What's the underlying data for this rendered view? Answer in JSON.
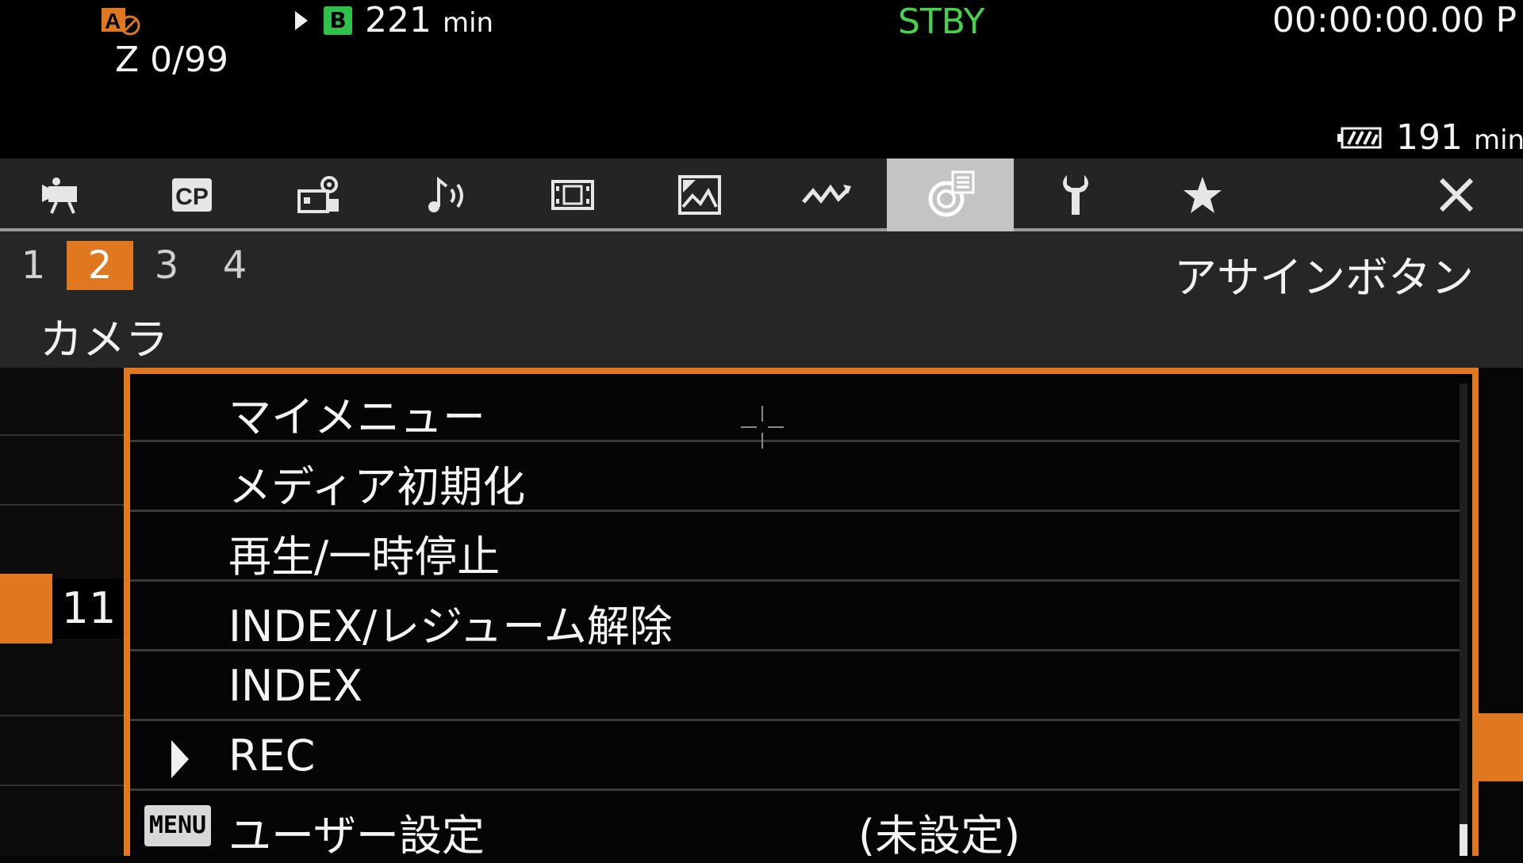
{
  "status_bar": {
    "af_icon": "af-lock-icon",
    "z_count": "Z 0/99",
    "slot": "B",
    "record_time": "221",
    "record_unit": "min",
    "mode": "STBY",
    "timecode": "00:00:00.00 P",
    "battery_time": "191",
    "battery_unit": "min"
  },
  "tabs": [
    {
      "name": "camera-icon",
      "active": false
    },
    {
      "name": "cp-icon",
      "label": "CP",
      "active": false
    },
    {
      "name": "camera-settings-icon",
      "active": false
    },
    {
      "name": "audio-icon",
      "active": false
    },
    {
      "name": "recording-icon",
      "active": false
    },
    {
      "name": "assist-icon",
      "active": false
    },
    {
      "name": "waveform-icon",
      "active": false
    },
    {
      "name": "assign-button-icon",
      "active": true
    },
    {
      "name": "wrench-icon",
      "active": false
    },
    {
      "name": "star-icon",
      "active": false
    },
    {
      "name": "close-icon",
      "active": false
    }
  ],
  "pages": [
    "1",
    "2",
    "3",
    "4"
  ],
  "active_page": "2",
  "section_title": "アサインボタン",
  "category": "カメラ",
  "selected_number": "11",
  "options": [
    {
      "label": "マイメニュー"
    },
    {
      "label": "メディア初期化"
    },
    {
      "label": "再生/一時停止"
    },
    {
      "label": "INDEX/レジューム解除"
    },
    {
      "label": "INDEX"
    },
    {
      "label": "REC",
      "cursor": true
    },
    {
      "label": "ユーザー設定",
      "value": "(未設定)",
      "badge": "MENU"
    }
  ],
  "colors": {
    "accent": "#e0781f",
    "stby": "#47d24c",
    "slot": "#2ec24a"
  }
}
